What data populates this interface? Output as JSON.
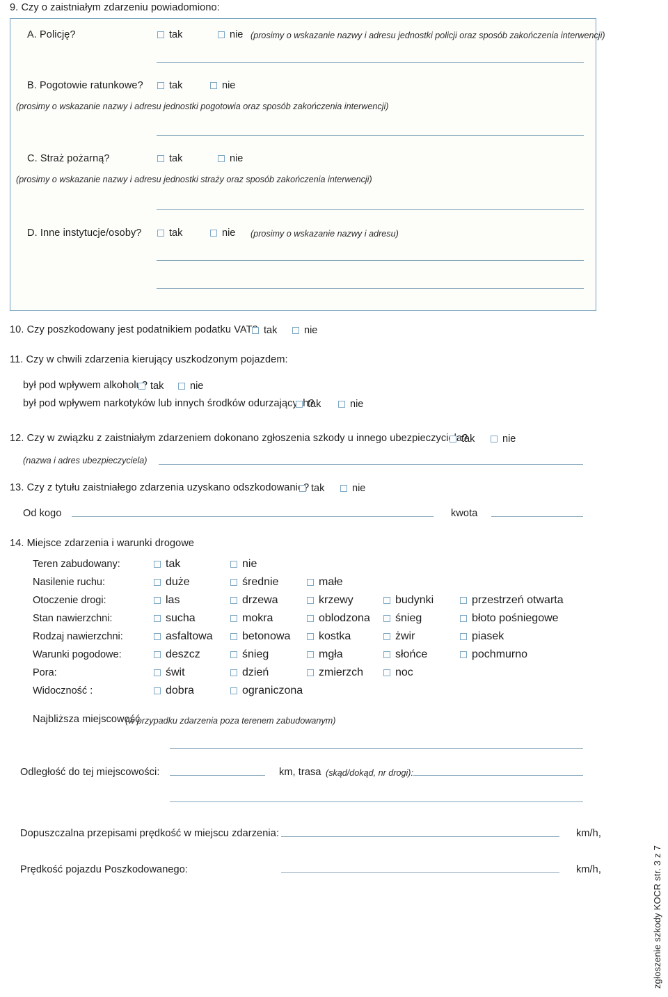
{
  "document": {
    "footer_vertical": "zgłoszenie szkody KOCR  str. 3 z 7",
    "accent_color": "#7fa3b8",
    "panel_border_color": "#6f9fc0",
    "checkbox_border_color": "#7da8c4"
  },
  "yes_no": {
    "yes": "tak",
    "no": "nie"
  },
  "q9": {
    "number": "9.",
    "title": "Czy o zaistniałym zdarzeniu powiadomiono:",
    "items": [
      {
        "key": "A",
        "label": "A. Policję?",
        "yes": "tak",
        "no": "nie",
        "hint": "(prosimy o wskazanie nazwy i adresu jednostki policji oraz sposób zakończenia interwencji)"
      },
      {
        "key": "B",
        "label": "B. Pogotowie ratunkowe?",
        "yes": "tak",
        "no": "nie",
        "hint": "(prosimy o wskazanie nazwy i adresu jednostki pogotowia oraz sposób zakończenia interwencji)"
      },
      {
        "key": "C",
        "label": "C. Straż pożarną?",
        "yes": "tak",
        "no": "nie",
        "hint": "(prosimy o wskazanie nazwy i adresu jednostki straży oraz sposób zakończenia interwencji)"
      },
      {
        "key": "D",
        "label": "D. Inne instytucje/osoby?",
        "yes": "tak",
        "no": "nie",
        "hint": "(prosimy o wskazanie nazwy i adresu)"
      }
    ]
  },
  "q10": {
    "number": "10.",
    "text": "Czy poszkodowany jest podatnikiem podatku VAT?",
    "yes": "tak",
    "no": "nie"
  },
  "q11": {
    "number": "11.",
    "text": "Czy w chwili zdarzenia kierujący uszkodzonym pojazdem:",
    "sub": [
      {
        "text": "był pod wpływem alkoholu?",
        "yes": "tak",
        "no": "nie"
      },
      {
        "text": "był pod wpływem narkotyków lub innych środków odurzających?",
        "yes": "tak",
        "no": "nie"
      }
    ]
  },
  "q12": {
    "number": "12.",
    "text": "Czy w związku z zaistniałym zdarzeniem dokonano zgłoszenia szkody u innego ubezpieczyciela?",
    "yes": "tak",
    "no": "nie",
    "hint": "(nazwa i adres ubezpieczyciela)"
  },
  "q13": {
    "number": "13.",
    "text": "Czy z tytułu zaistniałego zdarzenia uzyskano odszkodowanie?",
    "yes": "tak",
    "no": "nie",
    "from_label": "Od kogo",
    "amount_label": "kwota"
  },
  "q14": {
    "number": "14.",
    "title": "Miejsce zdarzenia i warunki drogowe",
    "rows": [
      {
        "name": "Teren zabudowany:",
        "options": [
          "tak",
          "nie"
        ]
      },
      {
        "name": "Nasilenie ruchu:",
        "options": [
          "duże",
          "średnie",
          "małe"
        ]
      },
      {
        "name": "Otoczenie drogi:",
        "options": [
          "las",
          "drzewa",
          "krzewy",
          "budynki",
          "przestrzeń otwarta"
        ]
      },
      {
        "name": "Stan nawierzchni:",
        "options": [
          "sucha",
          "mokra",
          "oblodzona",
          "śnieg",
          "błoto pośniegowe"
        ]
      },
      {
        "name": "Rodzaj nawierzchni:",
        "options": [
          "asfaltowa",
          "betonowa",
          "kostka",
          "żwir",
          "piasek"
        ]
      },
      {
        "name": "Warunki pogodowe:",
        "options": [
          "deszcz",
          "śnieg",
          "mgła",
          "słońce",
          "pochmurno"
        ]
      },
      {
        "name": "Pora:",
        "options": [
          "świt",
          "dzień",
          "zmierzch",
          "noc"
        ]
      },
      {
        "name": "Widoczność :",
        "options": [
          "dobra",
          "ograniczona"
        ]
      }
    ],
    "nearest_town_label": "Najbliższa miejscowość",
    "nearest_town_hint": "(w przypadku zdarzenia poza terenem zabudowanym)",
    "distance_label": "Odległość do tej miejscowości:",
    "distance_unit": "km, trasa",
    "route_hint": "(skąd/dokąd, nr drogi):",
    "speed_limit_label": "Dopuszczalna przepisami prędkość w miejscu zdarzenia:",
    "speed_limit_unit": "km/h,",
    "vehicle_speed_label": "Prędkość pojazdu Poszkodowanego:",
    "vehicle_speed_unit": "km/h,"
  }
}
